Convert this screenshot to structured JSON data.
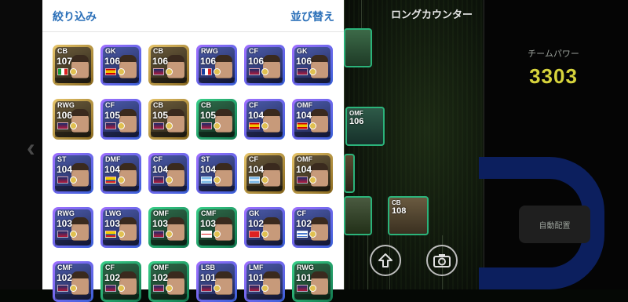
{
  "sheet": {
    "filter_label": "絞り込み",
    "sort_label": "並び替え"
  },
  "formation": {
    "title": "ロングカウンター",
    "players": [
      {
        "pos": "",
        "ovr": ""
      },
      {
        "pos": "OMF",
        "ovr": "106"
      },
      {
        "pos": "CB",
        "ovr": "108"
      },
      {
        "pos": "",
        "ovr": ""
      },
      {
        "pos": "",
        "ovr": ""
      }
    ]
  },
  "team": {
    "power_label": "チームパワー",
    "power_value": "3303",
    "auto_button": "自動配置"
  },
  "icons": {
    "upload": "upload-arrow-icon",
    "camera": "camera-icon",
    "back": "chevron-left-icon"
  },
  "cards": [
    {
      "pos": "CB",
      "ovr": "107",
      "flag": "it",
      "frame": "gold"
    },
    {
      "pos": "GK",
      "ovr": "106",
      "flag": "es",
      "frame": "purple"
    },
    {
      "pos": "CB",
      "ovr": "106",
      "flag": "club",
      "frame": "gold"
    },
    {
      "pos": "RWG",
      "ovr": "106",
      "flag": "fr",
      "frame": "purple"
    },
    {
      "pos": "CF",
      "ovr": "106",
      "flag": "club",
      "frame": "purple"
    },
    {
      "pos": "GK",
      "ovr": "106",
      "flag": "club",
      "frame": "purple"
    },
    {
      "pos": "RWG",
      "ovr": "106",
      "flag": "club",
      "frame": "gold"
    },
    {
      "pos": "CF",
      "ovr": "105",
      "flag": "club",
      "frame": "purple"
    },
    {
      "pos": "CB",
      "ovr": "105",
      "flag": "club",
      "frame": "gold"
    },
    {
      "pos": "CB",
      "ovr": "105",
      "flag": "club",
      "frame": "green"
    },
    {
      "pos": "CF",
      "ovr": "104",
      "flag": "es",
      "frame": "purple"
    },
    {
      "pos": "OMF",
      "ovr": "104",
      "flag": "es",
      "frame": "purple"
    },
    {
      "pos": "ST",
      "ovr": "104",
      "flag": "club",
      "frame": "purple"
    },
    {
      "pos": "DMF",
      "ovr": "104",
      "flag": "ec",
      "frame": "purple"
    },
    {
      "pos": "CF",
      "ovr": "104",
      "flag": "club",
      "frame": "purple"
    },
    {
      "pos": "ST",
      "ovr": "104",
      "flag": "ar",
      "frame": "purple"
    },
    {
      "pos": "CF",
      "ovr": "104",
      "flag": "ar",
      "frame": "gold"
    },
    {
      "pos": "OMF",
      "ovr": "104",
      "flag": "club",
      "frame": "gold"
    },
    {
      "pos": "RWG",
      "ovr": "103",
      "flag": "club",
      "frame": "purple"
    },
    {
      "pos": "LWG",
      "ovr": "103",
      "flag": "co",
      "frame": "purple"
    },
    {
      "pos": "OMF",
      "ovr": "103",
      "flag": "club",
      "frame": "green"
    },
    {
      "pos": "CMF",
      "ovr": "103",
      "flag": "en",
      "frame": "green"
    },
    {
      "pos": "GK",
      "ovr": "102",
      "flag": "ch",
      "frame": "purple"
    },
    {
      "pos": "CF",
      "ovr": "102",
      "flag": "uy",
      "frame": "purple"
    },
    {
      "pos": "CMF",
      "ovr": "102",
      "flag": "club",
      "frame": "purple"
    },
    {
      "pos": "CF",
      "ovr": "102",
      "flag": "club",
      "frame": "green"
    },
    {
      "pos": "OMF",
      "ovr": "102",
      "flag": "club",
      "frame": "green"
    },
    {
      "pos": "LSB",
      "ovr": "101",
      "flag": "club",
      "frame": "purple"
    },
    {
      "pos": "LMF",
      "ovr": "101",
      "flag": "club",
      "frame": "purple"
    },
    {
      "pos": "RWG",
      "ovr": "101",
      "flag": "club",
      "frame": "green"
    }
  ]
}
